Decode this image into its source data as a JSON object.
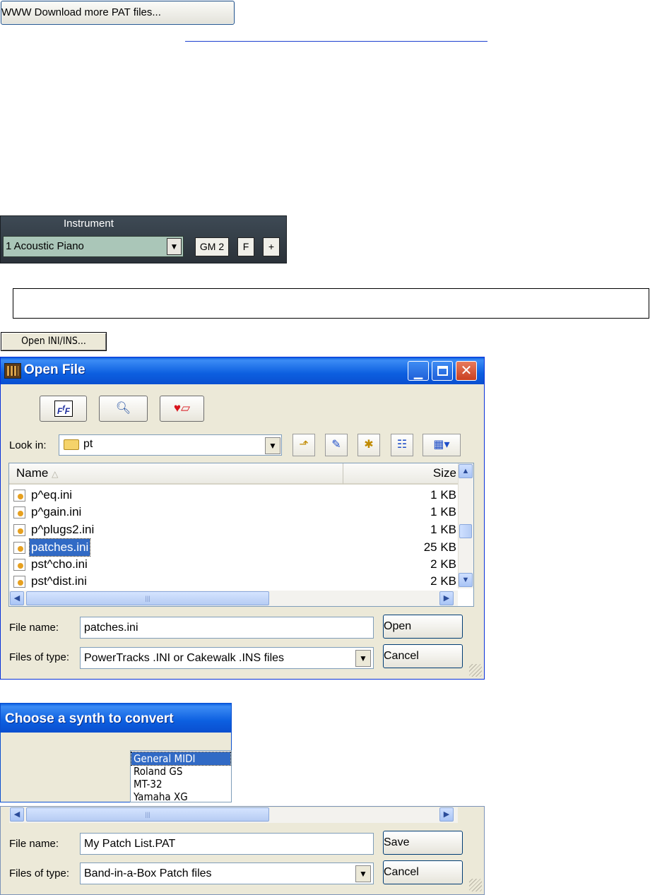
{
  "www_button": {
    "label": "WWW Download more PAT files..."
  },
  "instrument_panel": {
    "title": "Instrument",
    "selected": "1 Acoustic Piano",
    "buttons": {
      "gm2": "GM 2",
      "f": "F",
      "plus": "+"
    }
  },
  "open_ini_button": {
    "label": "Open INI/INS..."
  },
  "open_dialog": {
    "title": "Open File",
    "look_in_label": "Look in:",
    "look_in_value": "pt",
    "columns": {
      "name": "Name",
      "size": "Size"
    },
    "files": [
      {
        "name": "p^eq.ini",
        "size": "1 KB"
      },
      {
        "name": "p^gain.ini",
        "size": "1 KB"
      },
      {
        "name": "p^plugs2.ini",
        "size": "1 KB"
      },
      {
        "name": "patches.ini",
        "size": "25 KB",
        "selected": true
      },
      {
        "name": "pst^cho.ini",
        "size": "2 KB"
      },
      {
        "name": "pst^dist.ini",
        "size": "2 KB"
      }
    ],
    "file_name_label": "File name:",
    "file_name_value": "patches.ini",
    "files_of_type_label": "Files of type:",
    "files_of_type_value": "PowerTracks .INI or Cakewalk .INS files",
    "open_button": "Open",
    "cancel_button": "Cancel"
  },
  "synth_dialog": {
    "title": "Choose a synth to convert",
    "items": [
      "General MIDI",
      "Roland GS",
      "MT-32",
      "Yamaha XG"
    ],
    "selected_index": 0
  },
  "save_dialog": {
    "file_name_label": "File name:",
    "file_name_value": "My Patch List.PAT",
    "files_of_type_label": "Files of type:",
    "files_of_type_value": "Band-in-a-Box Patch files",
    "save_button": "Save",
    "cancel_button": "Cancel"
  }
}
